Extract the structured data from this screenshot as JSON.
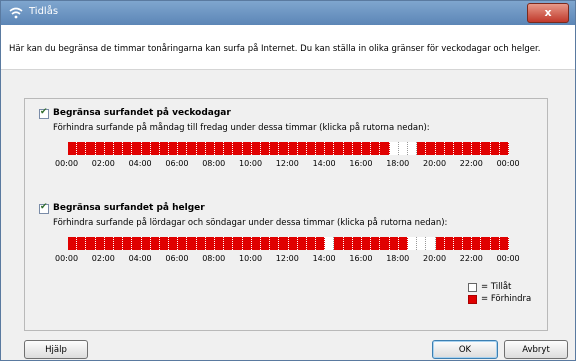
{
  "window": {
    "title": "Tidlås",
    "close_label": "x"
  },
  "intro": "Här kan du begränsa de timmar tonåringarna kan surfa på Internet. Du kan ställa in olika gränser för veckodagar och helger.",
  "weekdays": {
    "label": "Begränsa surfandet på veckodagar",
    "checked": true,
    "description": "Förhindra surfande på måndag till fredag under dessa timmar (klicka på rutorna nedan):",
    "allowed_slots": [
      35,
      36,
      37
    ]
  },
  "weekends": {
    "label": "Begränsa surfandet på helger",
    "checked": true,
    "description": "Förhindra surfande på lördagar och söndagar under dessa timmar (klicka på rutorna nedan):",
    "allowed_slots": [
      28,
      37,
      38,
      39
    ]
  },
  "ticks": [
    "00:00",
    "02:00",
    "04:00",
    "06:00",
    "08:00",
    "10:00",
    "12:00",
    "14:00",
    "16:00",
    "18:00",
    "20:00",
    "22:00",
    "00:00"
  ],
  "legend": {
    "allowed": "= Tillåt",
    "blocked": "= Förhindra"
  },
  "buttons": {
    "help": "Hjälp",
    "ok": "OK",
    "cancel": "Avbryt"
  },
  "colors": {
    "blocked": "#e00000",
    "allowed": "#ffffff"
  }
}
